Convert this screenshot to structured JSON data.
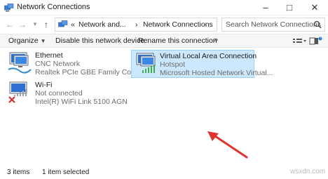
{
  "window": {
    "title": "Network Connections"
  },
  "address": {
    "crumb_lead": "«",
    "crumb_1": "Network and...",
    "crumb_sep": "›",
    "crumb_2": "Network Connections"
  },
  "search": {
    "placeholder": "Search Network Connections"
  },
  "toolbar": {
    "organize": "Organize",
    "disable": "Disable this network device",
    "rename": "Rename this connection",
    "more": "»"
  },
  "items": [
    {
      "name": "Ethernet",
      "line1": "CNC Network",
      "line2": "Realtek PCIe GBE Family Controller"
    },
    {
      "name": "Wi-Fi",
      "line1": "Not connected",
      "line2": "Intel(R) WiFi Link 5100 AGN"
    },
    {
      "name": "Virtual Local Area Connection",
      "line1": "Hotspot",
      "line2": "Microsoft Hosted Network Virtual..."
    }
  ],
  "status": {
    "count": "3 items",
    "selected": "1 item selected"
  },
  "watermark": "wsxdn.com",
  "colors": {
    "selection": "#cce8ff",
    "arrow": "#e0322e"
  }
}
